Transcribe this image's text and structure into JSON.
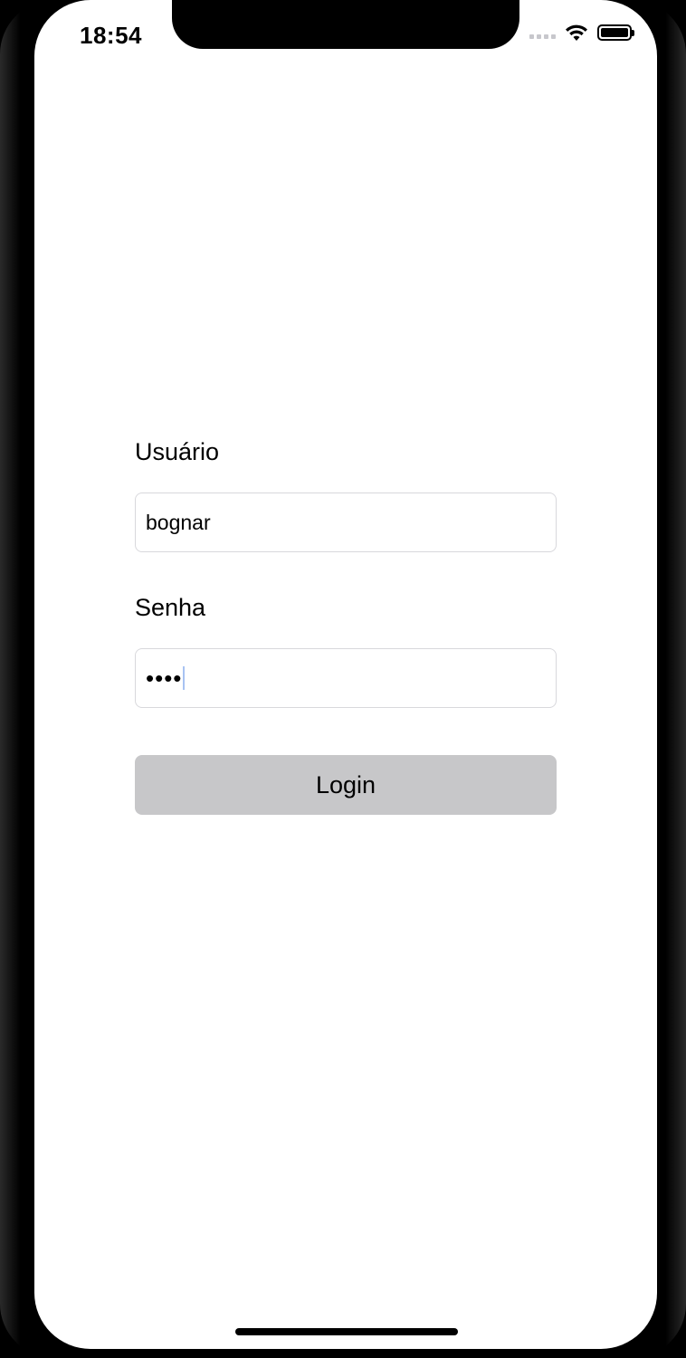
{
  "status_bar": {
    "time": "18:54",
    "icons": [
      "cellular-signal-icon",
      "wifi-icon",
      "battery-icon"
    ]
  },
  "login_form": {
    "username_label": "Usuário",
    "username_value": "bognar",
    "password_label": "Senha",
    "password_masked": "••••",
    "login_button_label": "Login"
  },
  "colors": {
    "button_background": "#c7c7c9",
    "input_border": "#d8d8dc",
    "cursor": "#a8c3f2"
  }
}
